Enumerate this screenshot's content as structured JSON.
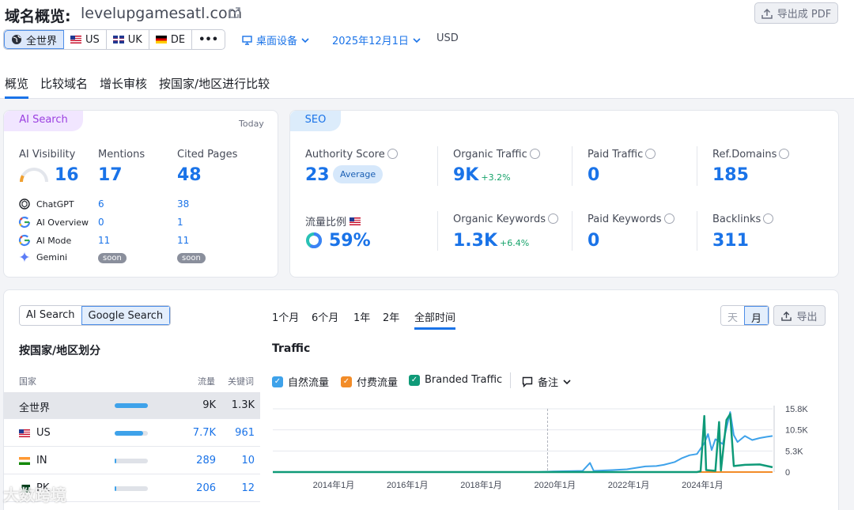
{
  "header": {
    "title": "域名概览:",
    "domain": "levelupgamesatl.com",
    "export_pdf": "导出成 PDF"
  },
  "filters": {
    "regions": [
      {
        "label": "全世界",
        "icon": "globe-icon"
      },
      {
        "label": "US",
        "icon": "flag-us-icon"
      },
      {
        "label": "UK",
        "icon": "flag-uk-icon"
      },
      {
        "label": "DE",
        "icon": "flag-de-icon"
      },
      {
        "label": "•••",
        "icon": "more-icon"
      }
    ],
    "device": "桌面设备",
    "date": "2025年12月1日",
    "currency": "USD"
  },
  "tabs": [
    "概览",
    "比较域名",
    "增长审核",
    "按国家/地区进行比较"
  ],
  "ai_card": {
    "pill": "AI Search",
    "today": "Today",
    "visibility_label": "AI Visibility",
    "visibility_value": "16",
    "visibility_fraction": 0.16,
    "mentions_label": "Mentions",
    "mentions_value": "17",
    "cited_label": "Cited Pages",
    "cited_value": "48",
    "engines": [
      {
        "name": "ChatGPT",
        "mentions": "6",
        "cited": "38"
      },
      {
        "name": "AI Overview",
        "mentions": "0",
        "cited": "1"
      },
      {
        "name": "AI Mode",
        "mentions": "11",
        "cited": "11"
      },
      {
        "name": "Gemini",
        "mentions": "soon",
        "cited": "soon"
      }
    ]
  },
  "seo_card": {
    "pill": "SEO",
    "authority_label": "Authority Score",
    "authority_value": "23",
    "authority_badge": "Average",
    "organic_traffic_label": "Organic Traffic",
    "organic_traffic_value": "9K",
    "organic_traffic_delta": "+3.2%",
    "paid_traffic_label": "Paid Traffic",
    "paid_traffic_value": "0",
    "ref_domains_label": "Ref.Domains",
    "ref_domains_value": "185",
    "traffic_share_label": "流量比例",
    "traffic_share_value": "59%",
    "traffic_share_fraction": 0.59,
    "organic_kw_label": "Organic Keywords",
    "organic_kw_value": "1.3K",
    "organic_kw_delta": "+6.4%",
    "paid_kw_label": "Paid Keywords",
    "paid_kw_value": "0",
    "backlinks_label": "Backlinks",
    "backlinks_value": "311"
  },
  "bottom": {
    "search_toggle": [
      "AI Search",
      "Google Search"
    ],
    "country_title": "按国家/地区划分",
    "col_country": "国家",
    "col_traffic": "流量",
    "col_keywords": "关键词",
    "countries": [
      {
        "name": "全世界",
        "traffic": "9K",
        "keywords": "1.3K",
        "share": 1.0
      },
      {
        "name": "US",
        "traffic": "7.7K",
        "keywords": "961",
        "share": 0.86
      },
      {
        "name": "IN",
        "traffic": "289",
        "keywords": "10",
        "share": 0.03
      },
      {
        "name": "PK",
        "traffic": "206",
        "keywords": "12",
        "share": 0.02
      }
    ],
    "periods": [
      "1个月",
      "6个月",
      "1年",
      "2年",
      "全部时间"
    ],
    "day_month": [
      "天",
      "月"
    ],
    "export": "导出",
    "traffic_title": "Traffic",
    "legend": [
      {
        "label": "自然流量",
        "color": "#3ea2ea"
      },
      {
        "label": "付费流量",
        "color": "#f28c28"
      },
      {
        "label": "Branded Traffic",
        "color": "#0f9a78"
      }
    ],
    "notes": "备注"
  },
  "watermark": "大数跨境",
  "chart_data": {
    "type": "line",
    "title": "Traffic",
    "x_ticks": [
      "2014年1月",
      "2016年1月",
      "2018年1月",
      "2020年1月",
      "2022年1月",
      "2024年1月"
    ],
    "y_ticks": [
      "15.8K",
      "10.5K",
      "5.3K",
      "0"
    ],
    "ylim": [
      0,
      15800
    ],
    "xlim": [
      2012.4,
      2025.95
    ],
    "series": [
      {
        "name": "自然流量",
        "color": "#3ea2ea",
        "points": [
          [
            2012.4,
            0
          ],
          [
            2019.6,
            0
          ],
          [
            2020.0,
            150
          ],
          [
            2020.8,
            300
          ],
          [
            2021.0,
            2300
          ],
          [
            2021.1,
            300
          ],
          [
            2021.6,
            500
          ],
          [
            2022.0,
            700
          ],
          [
            2022.5,
            1400
          ],
          [
            2022.8,
            1500
          ],
          [
            2023.0,
            1800
          ],
          [
            2023.3,
            2500
          ],
          [
            2023.5,
            3500
          ],
          [
            2023.7,
            4200
          ],
          [
            2023.9,
            4500
          ],
          [
            2024.1,
            7200
          ],
          [
            2024.2,
            9500
          ],
          [
            2024.3,
            5500
          ],
          [
            2024.4,
            8200
          ],
          [
            2024.6,
            7000
          ],
          [
            2024.8,
            15000
          ],
          [
            2024.9,
            9200
          ],
          [
            2025.0,
            7500
          ],
          [
            2025.2,
            9000
          ],
          [
            2025.4,
            8000
          ],
          [
            2025.6,
            8500
          ],
          [
            2025.8,
            8800
          ],
          [
            2025.95,
            9000
          ]
        ]
      },
      {
        "name": "付费流量",
        "color": "#f28c28",
        "points": [
          [
            2012.4,
            0
          ],
          [
            2025.95,
            0
          ]
        ]
      },
      {
        "name": "Branded Traffic",
        "color": "#0f9a78",
        "points": [
          [
            2012.4,
            0
          ],
          [
            2023.9,
            0
          ],
          [
            2024.0,
            200
          ],
          [
            2024.1,
            14000
          ],
          [
            2024.15,
            500
          ],
          [
            2024.4,
            300
          ],
          [
            2024.5,
            12500
          ],
          [
            2024.55,
            400
          ],
          [
            2024.7,
            13000
          ],
          [
            2024.8,
            14500
          ],
          [
            2024.9,
            1500
          ],
          [
            2025.2,
            1800
          ],
          [
            2025.6,
            1900
          ],
          [
            2025.95,
            1200
          ]
        ]
      }
    ],
    "annotation_x": 2019.85
  }
}
